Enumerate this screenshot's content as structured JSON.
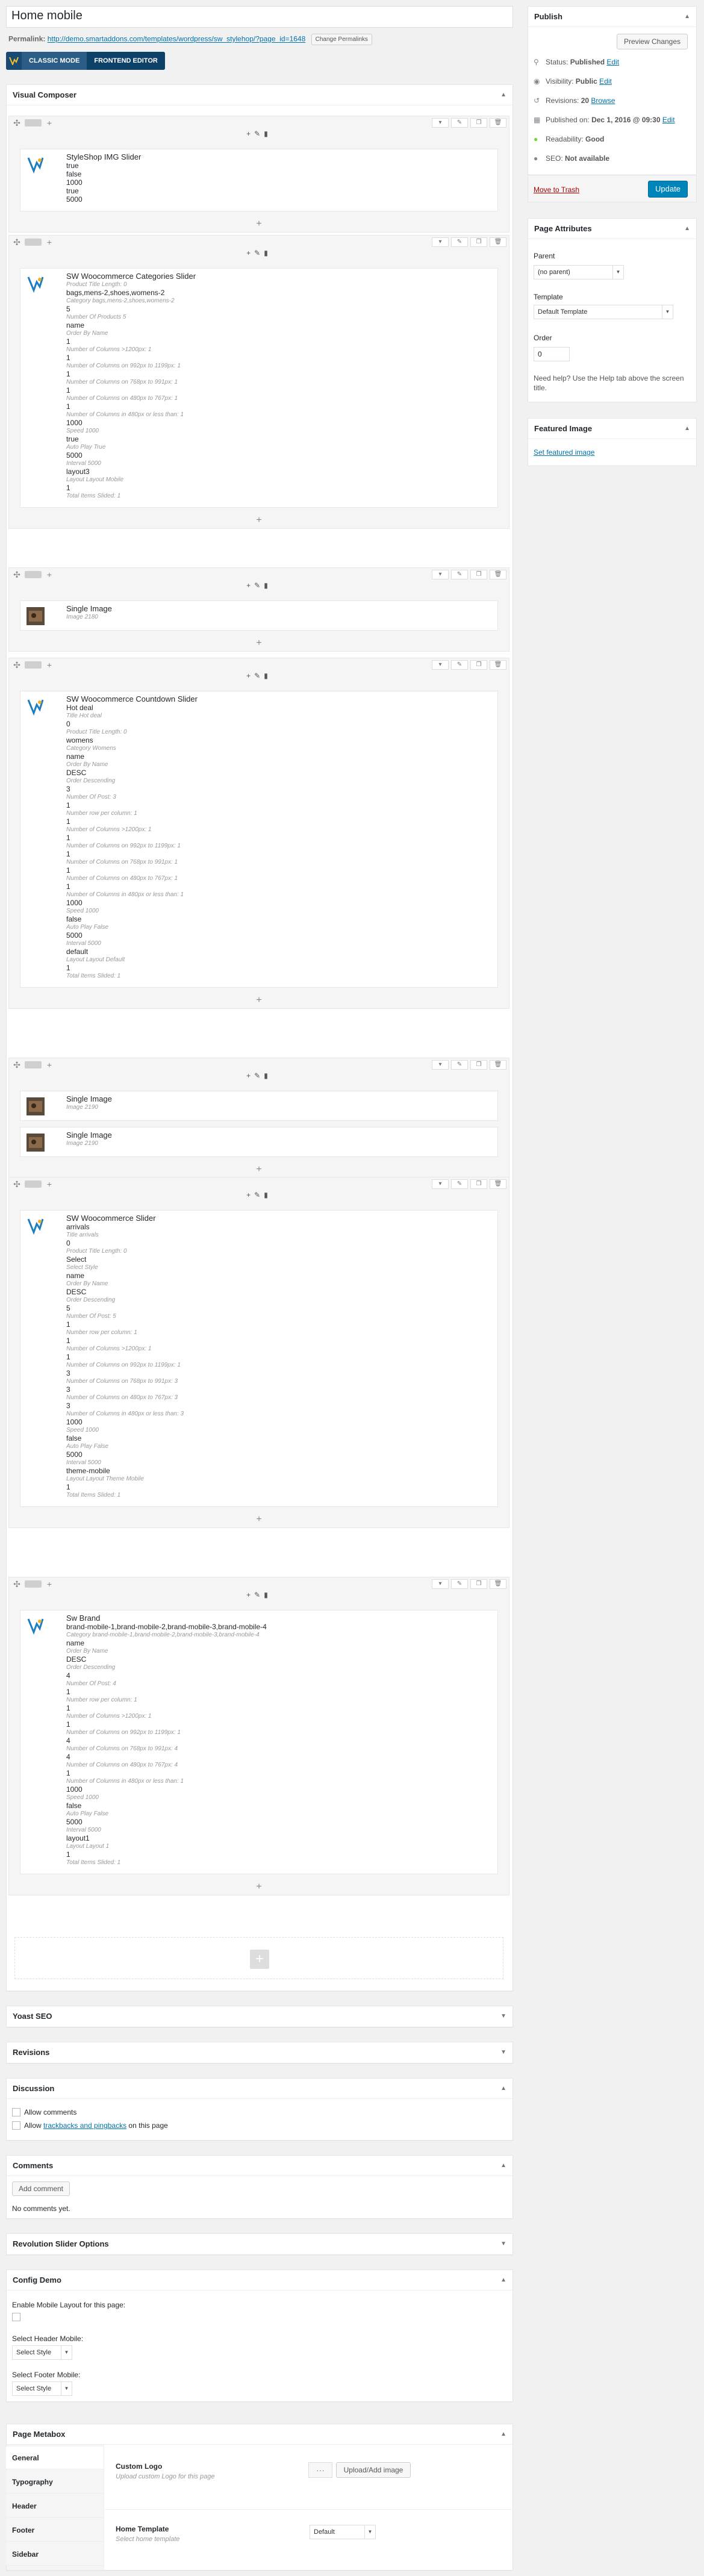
{
  "title": "Home mobile",
  "permalink": {
    "label": "Permalink:",
    "url": "http://demo.smartaddons.com/templates/wordpress/sw_stylehop/?page_id=1648",
    "button": "Change Permalinks"
  },
  "vc_modes": {
    "classic": "CLASSIC MODE",
    "frontend": "FRONTEND EDITOR"
  },
  "visual_composer": {
    "title": "Visual Composer",
    "rows": [
      {
        "elements": [
          {
            "name": "StyleShop IMG Slider",
            "lines": [
              [
                "v",
                "true"
              ],
              [
                "v",
                "false"
              ],
              [
                "v",
                "1000"
              ],
              [
                "v",
                "true"
              ],
              [
                "v",
                "5000"
              ]
            ]
          }
        ]
      },
      {
        "elements": [
          {
            "name": "SW Woocommerce Categories Slider",
            "lines": [
              [
                "s",
                "Product Title Length: 0"
              ],
              [
                "v",
                "bags,mens-2,shoes,womens-2"
              ],
              [
                "s",
                "Category bags,mens-2,shoes,womens-2"
              ],
              [
                "v",
                "5"
              ],
              [
                "s",
                "Number Of Products 5"
              ],
              [
                "v",
                "name"
              ],
              [
                "s",
                "Order By Name"
              ],
              [
                "v",
                "1"
              ],
              [
                "s",
                "Number of Columns >1200px: 1"
              ],
              [
                "v",
                "1"
              ],
              [
                "s",
                "Number of Columns on 992px to 1199px: 1"
              ],
              [
                "v",
                "1"
              ],
              [
                "s",
                "Number of Columns on 768px to 991px: 1"
              ],
              [
                "v",
                "1"
              ],
              [
                "s",
                "Number of Columns on 480px to 767px: 1"
              ],
              [
                "v",
                "1"
              ],
              [
                "s",
                "Number of Columns in 480px or less than: 1"
              ],
              [
                "v",
                "1000"
              ],
              [
                "s",
                "Speed 1000"
              ],
              [
                "v",
                "true"
              ],
              [
                "s",
                "Auto Play True"
              ],
              [
                "v",
                "5000"
              ],
              [
                "s",
                "Interval 5000"
              ],
              [
                "v",
                "layout3"
              ],
              [
                "s",
                "Layout Layout Mobile"
              ],
              [
                "v",
                "1"
              ],
              [
                "s",
                "Total Items Slided: 1"
              ]
            ]
          }
        ]
      },
      {
        "elements": [
          {
            "name": "Single Image",
            "lines": [
              [
                "s",
                "Image 2180"
              ]
            ]
          }
        ]
      },
      {
        "elements": [
          {
            "name": "SW Woocommerce Countdown Slider",
            "lines": [
              [
                "v",
                "Hot deal"
              ],
              [
                "s",
                "Title Hot deal"
              ],
              [
                "v",
                "0"
              ],
              [
                "s",
                "Product Title Length: 0"
              ],
              [
                "v",
                "womens"
              ],
              [
                "s",
                "Category Womens"
              ],
              [
                "v",
                "name"
              ],
              [
                "s",
                "Order By Name"
              ],
              [
                "v",
                "DESC"
              ],
              [
                "s",
                "Order Descending"
              ],
              [
                "v",
                "3"
              ],
              [
                "s",
                "Number Of Post: 3"
              ],
              [
                "v",
                "1"
              ],
              [
                "s",
                "Number row per column: 1"
              ],
              [
                "v",
                "1"
              ],
              [
                "s",
                "Number of Columns >1200px: 1"
              ],
              [
                "v",
                "1"
              ],
              [
                "s",
                "Number of Columns on 992px to 1199px: 1"
              ],
              [
                "v",
                "1"
              ],
              [
                "s",
                "Number of Columns on 768px to 991px: 1"
              ],
              [
                "v",
                "1"
              ],
              [
                "s",
                "Number of Columns on 480px to 767px: 1"
              ],
              [
                "v",
                "1"
              ],
              [
                "s",
                "Number of Columns in 480px or less than: 1"
              ],
              [
                "v",
                "1000"
              ],
              [
                "s",
                "Speed 1000"
              ],
              [
                "v",
                "false"
              ],
              [
                "s",
                "Auto Play False"
              ],
              [
                "v",
                "5000"
              ],
              [
                "s",
                "Interval 5000"
              ],
              [
                "v",
                "default"
              ],
              [
                "s",
                "Layout Layout Default"
              ],
              [
                "v",
                "1"
              ],
              [
                "s",
                "Total Items Slided: 1"
              ]
            ]
          }
        ]
      },
      {
        "elements": [
          {
            "name": "Single Image",
            "lines": [
              [
                "s",
                "Image 2190"
              ]
            ]
          },
          {
            "name": "Single Image",
            "lines": [
              [
                "s",
                "Image 2190"
              ]
            ]
          }
        ]
      },
      {
        "elements": [
          {
            "name": "SW Woocommerce Slider",
            "lines": [
              [
                "v",
                "arrivals"
              ],
              [
                "s",
                "Title arrivals"
              ],
              [
                "v",
                "0"
              ],
              [
                "s",
                "Product Title Length: 0"
              ],
              [
                "v",
                "Select"
              ],
              [
                "s",
                "Select Style"
              ],
              [
                "v",
                "name"
              ],
              [
                "s",
                "Order By Name"
              ],
              [
                "v",
                "DESC"
              ],
              [
                "s",
                "Order Descending"
              ],
              [
                "v",
                "5"
              ],
              [
                "s",
                "Number Of Post: 5"
              ],
              [
                "v",
                "1"
              ],
              [
                "s",
                "Number row per column: 1"
              ],
              [
                "v",
                "1"
              ],
              [
                "s",
                "Number of Columns >1200px: 1"
              ],
              [
                "v",
                "1"
              ],
              [
                "s",
                "Number of Columns on 992px to 1199px: 1"
              ],
              [
                "v",
                "3"
              ],
              [
                "s",
                "Number of Columns on 768px to 991px: 3"
              ],
              [
                "v",
                "3"
              ],
              [
                "s",
                "Number of Columns on 480px to 767px: 3"
              ],
              [
                "v",
                "3"
              ],
              [
                "s",
                "Number of Columns in 480px or less than: 3"
              ],
              [
                "v",
                "1000"
              ],
              [
                "s",
                "Speed 1000"
              ],
              [
                "v",
                "false"
              ],
              [
                "s",
                "Auto Play False"
              ],
              [
                "v",
                "5000"
              ],
              [
                "s",
                "Interval 5000"
              ],
              [
                "v",
                "theme-mobile"
              ],
              [
                "s",
                "Layout Layout Theme Mobile"
              ],
              [
                "v",
                "1"
              ],
              [
                "s",
                "Total Items Slided: 1"
              ]
            ]
          }
        ]
      },
      {
        "elements": [
          {
            "name": "Sw Brand",
            "lines": [
              [
                "v",
                "brand-mobile-1,brand-mobile-2,brand-mobile-3,brand-mobile-4"
              ],
              [
                "s",
                "Category brand-mobile-1,brand-mobile-2,brand-mobile-3,brand-mobile-4"
              ],
              [
                "v",
                "name"
              ],
              [
                "s",
                "Order By Name"
              ],
              [
                "v",
                "DESC"
              ],
              [
                "s",
                "Order Descending"
              ],
              [
                "v",
                "4"
              ],
              [
                "s",
                "Number Of Post: 4"
              ],
              [
                "v",
                "1"
              ],
              [
                "s",
                "Number row per column: 1"
              ],
              [
                "v",
                "1"
              ],
              [
                "s",
                "Number of Columns >1200px: 1"
              ],
              [
                "v",
                "1"
              ],
              [
                "s",
                "Number of Columns on 992px to 1199px: 1"
              ],
              [
                "v",
                "4"
              ],
              [
                "s",
                "Number of Columns on 768px to 991px: 4"
              ],
              [
                "v",
                "4"
              ],
              [
                "s",
                "Number of Columns on 480px to 767px: 4"
              ],
              [
                "v",
                "1"
              ],
              [
                "s",
                "Number of Columns in 480px or less than: 1"
              ],
              [
                "v",
                "1000"
              ],
              [
                "s",
                "Speed 1000"
              ],
              [
                "v",
                "false"
              ],
              [
                "s",
                "Auto Play False"
              ],
              [
                "v",
                "5000"
              ],
              [
                "s",
                "Interval 5000"
              ],
              [
                "v",
                "layout1"
              ],
              [
                "s",
                "Layout Layout 1"
              ],
              [
                "v",
                "1"
              ],
              [
                "s",
                "Total Items Slided: 1"
              ]
            ]
          }
        ]
      }
    ]
  },
  "boxes": {
    "yoast": "Yoast SEO",
    "revisions": "Revisions",
    "discussion": "Discussion",
    "allow_comments": "Allow comments",
    "allow_tb_pre": "Allow ",
    "allow_tb_link": "trackbacks and pingbacks",
    "allow_tb_post": " on this page",
    "comments": "Comments",
    "add_comment": "Add comment",
    "no_comments": "No comments yet.",
    "revslider": "Revolution Slider Options",
    "config_demo": "Config Demo",
    "enable_mobile": "Enable Mobile Layout for this page:",
    "select_header": "Select Header Mobile:",
    "select_footer": "Select Footer Mobile:",
    "select_style": "Select Style",
    "page_metabox": "Page Metabox"
  },
  "metabox": {
    "tabs": [
      "General",
      "Typography",
      "Header",
      "Footer",
      "Sidebar"
    ],
    "custom_logo": "Custom Logo",
    "custom_logo_desc": "Upload custom Logo for this page",
    "upload_btn": "Upload/Add image",
    "home_template": "Home Template",
    "home_template_desc": "Select home template",
    "home_template_val": "Default"
  },
  "publish": {
    "title": "Publish",
    "preview": "Preview Changes",
    "status_label": "Status: ",
    "status_val": "Published",
    "visibility_label": "Visibility: ",
    "visibility_val": "Public",
    "revisions_label": "Revisions: ",
    "revisions_val": "20",
    "browse": "Browse",
    "published_on": "Published on: ",
    "published_date": "Dec 1, 2016 @ 09:30",
    "readability_label": "Readability: ",
    "readability_val": "Good",
    "seo_label": "SEO: ",
    "seo_val": "Not available",
    "edit": "Edit",
    "trash": "Move to Trash",
    "update": "Update"
  },
  "page_attributes": {
    "title": "Page Attributes",
    "parent": "Parent",
    "parent_val": "(no parent)",
    "template": "Template",
    "template_val": "Default Template",
    "order": "Order",
    "order_val": "0",
    "help": "Need help? Use the Help tab above the screen title."
  },
  "featured": {
    "title": "Featured Image",
    "link": "Set featured image"
  },
  "colors": {
    "accent": "#0073aa",
    "trash": "#a00",
    "update_bg": "#0085ba",
    "vc_blue": "#0e4168",
    "readability_good": "#7ad03a"
  },
  "icons": [
    "add-icon",
    "layout-icon",
    "pencil-icon",
    "copy-icon",
    "trash-icon",
    "pin-icon",
    "eye-icon",
    "clock-icon",
    "calendar-icon",
    "readability-icon",
    "seo-icon"
  ]
}
